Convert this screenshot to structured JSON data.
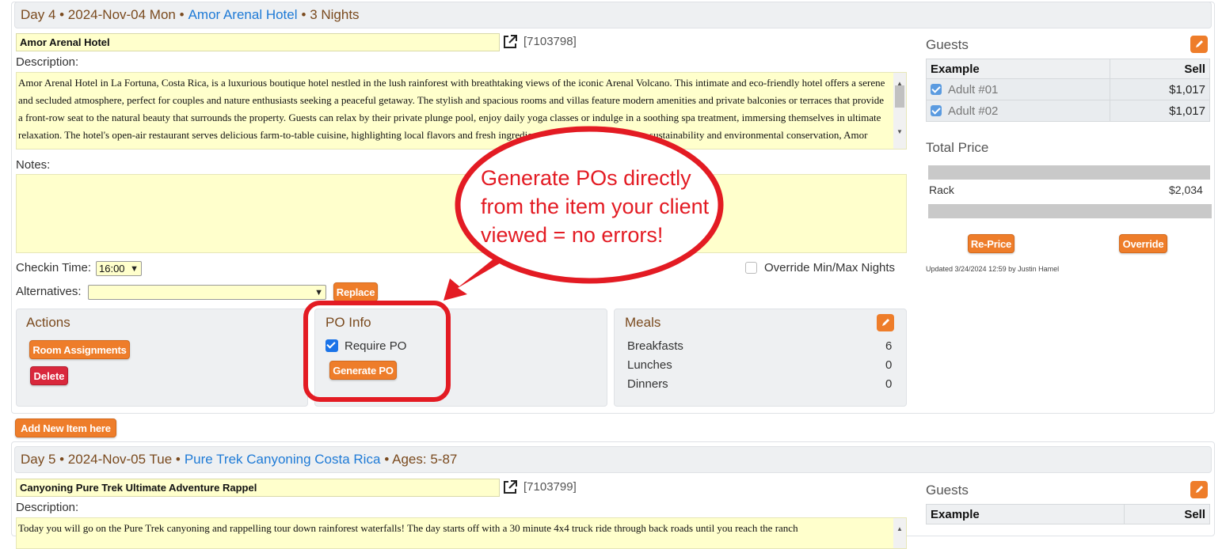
{
  "day4": {
    "header_prefix": "Day 4 • 2024-Nov-04 Mon •",
    "hotel_link": "Amor Arenal Hotel",
    "header_suffix": "• 3 Nights",
    "item_name": "Amor Arenal Hotel",
    "item_id": "[7103798]",
    "description_label": "Description:",
    "description_text": "Amor Arenal Hotel in La Fortuna, Costa Rica, is a luxurious boutique hotel nestled in the lush rainforest with breathtaking views of the iconic Arenal Volcano. This intimate and eco-friendly hotel offers a serene and secluded atmosphere, perfect for couples and nature enthusiasts seeking a peaceful getaway. The stylish and spacious rooms and villas feature modern amenities and private balconies or terraces that provide a front-row seat to the natural beauty that surrounds the property. Guests can relax by their private plunge pool, enjoy daily yoga classes or indulge in a soothing spa treatment, immersing themselves in ultimate relaxation. The hotel's open-air restaurant serves delicious farm-to-table cuisine, highlighting local flavors and fresh ingredients. With its commitment to sustainability and environmental conservation, Amor Arenal Hotel offers a unique blend of luxury and eco-consciousness. The hotel's friendly and knowledgeable staff",
    "notes_label": "Notes:",
    "checkin_label": "Checkin Time:",
    "checkin_value": "16:00",
    "override_label": "Override Min/Max Nights",
    "alternatives_label": "Alternatives:",
    "replace_button": "Replace",
    "actions": {
      "title": "Actions",
      "room_assignments": "Room Assignments",
      "delete": "Delete"
    },
    "po_info": {
      "title": "PO Info",
      "require_po": "Require PO",
      "generate_po": "Generate PO"
    },
    "meals": {
      "title": "Meals",
      "rows": [
        {
          "label": "Breakfasts",
          "value": "6"
        },
        {
          "label": "Lunches",
          "value": "0"
        },
        {
          "label": "Dinners",
          "value": "0"
        }
      ]
    },
    "guests": {
      "title": "Guests",
      "col_name": "Example",
      "col_sell": "Sell",
      "rows": [
        {
          "name": "Adult #01",
          "sell": "$1,017"
        },
        {
          "name": "Adult #02",
          "sell": "$1,017"
        }
      ]
    },
    "total": {
      "title": "Total Price",
      "rack_label": "Rack",
      "rack_value": "$2,034",
      "reprice_button": "Re-Price",
      "override_button": "Override",
      "updated_text": "Updated 3/24/2024 12:59 by Justin Hamel"
    }
  },
  "add_new_item": "Add New Item here",
  "callout": {
    "line1": "Generate POs directly",
    "line2": "from the item your client",
    "line3": "viewed = no errors!",
    "color": "#e31b23"
  },
  "day5": {
    "header_prefix": "Day 5 • 2024-Nov-05 Tue •",
    "activity_link": "Pure Trek Canyoning Costa Rica",
    "header_suffix": "• Ages: 5-87",
    "item_name": "Canyoning Pure Trek Ultimate Adventure Rappel",
    "item_id": "[7103799]",
    "description_label": "Description:",
    "description_text": "Today you will go on the Pure Trek canyoning and rappelling tour down rainforest waterfalls!  The day starts off with a 30 minute 4x4 truck ride through back roads until you reach the ranch",
    "guests": {
      "title": "Guests",
      "col_name": "Example",
      "col_sell": "Sell"
    }
  },
  "colors": {
    "accent_orange": "#ee7d2a",
    "link_blue": "#1e7ad6",
    "header_brown": "#7a4a1e",
    "input_yellow": "#ffffcc",
    "delete_red": "#d9283c"
  }
}
